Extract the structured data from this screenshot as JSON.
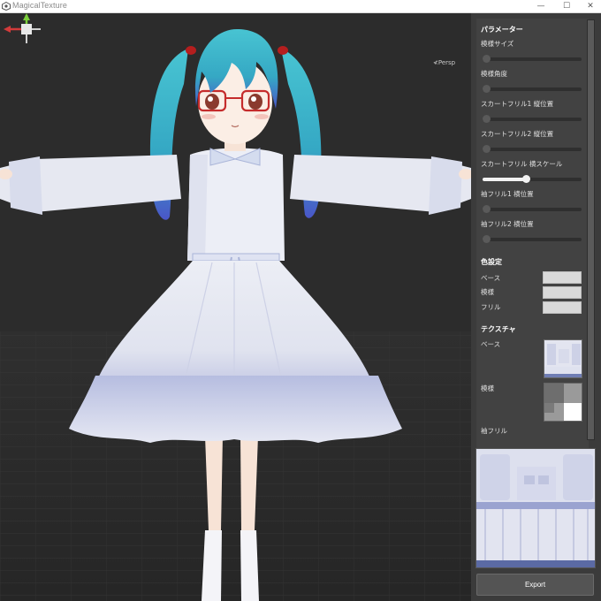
{
  "window": {
    "title": "MagicalTexture",
    "controls": {
      "minimize": "—",
      "maximize": "☐",
      "close": "✕"
    }
  },
  "viewport": {
    "persp_label": "≮Persp",
    "gizmo_icon": "axis-gizmo-icon"
  },
  "panel": {
    "parameters_title": "パラメーター",
    "sliders": [
      {
        "label": "模様サイズ",
        "value": 0.0
      },
      {
        "label": "模様角度",
        "value": 0.0
      },
      {
        "label": "スカートフリル1 縦位置",
        "value": 0.0
      },
      {
        "label": "スカートフリル2 縦位置",
        "value": 0.0
      },
      {
        "label": "スカートフリル 横スケール",
        "value": 0.44
      },
      {
        "label": "袖フリル1 横位置",
        "value": 0.0
      },
      {
        "label": "袖フリル2 横位置",
        "value": 0.0
      }
    ],
    "color_title": "色設定",
    "colors": [
      {
        "label": "ベース",
        "color": "#d9d9d9"
      },
      {
        "label": "模様",
        "color": "#d9d9d9"
      },
      {
        "label": "フリル",
        "color": "#d9d9d9"
      }
    ],
    "texture_title": "テクスチャ",
    "textures": [
      {
        "label": "ベース"
      },
      {
        "label": "模様"
      },
      {
        "label": "袖フリル"
      }
    ],
    "export_label": "Export"
  },
  "colors": {
    "background": "#2b2b2b",
    "panel": "#3b3b3b",
    "accent_hair": "#3fb8c9",
    "dress": "#e4e6f0",
    "dress_shadow": "#9aa3d0"
  }
}
